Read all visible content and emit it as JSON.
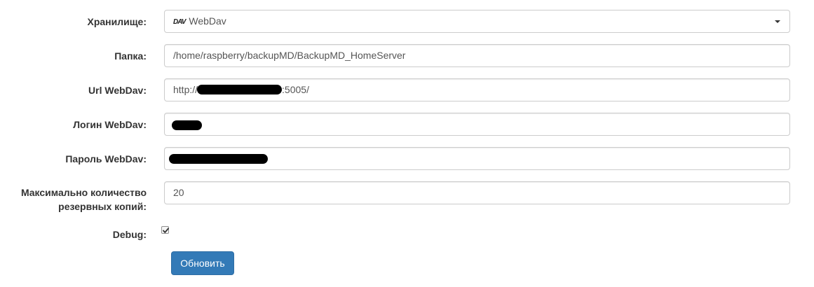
{
  "form": {
    "storage": {
      "label": "Хранилище:",
      "logo_text": "DAV",
      "value": "WebDav"
    },
    "folder": {
      "label": "Папка:",
      "value": "/home/raspberry/backupMD/BackupMD_HomeServer"
    },
    "url": {
      "label": "Url WebDav:",
      "value_prefix": "http://",
      "value_suffix": ":5005/"
    },
    "login": {
      "label": "Логин WebDav:"
    },
    "password": {
      "label": "Пароль WebDav:"
    },
    "max_copies": {
      "label_line1": "Максимально количество",
      "label_line2": "резервных копий:",
      "value": "20"
    },
    "debug": {
      "label": "Debug:",
      "checked": true
    },
    "submit_label": "Обновить"
  },
  "colors": {
    "primary": "#337ab7",
    "border": "#cccccc",
    "label_text": "#333333",
    "input_text": "#555555"
  }
}
